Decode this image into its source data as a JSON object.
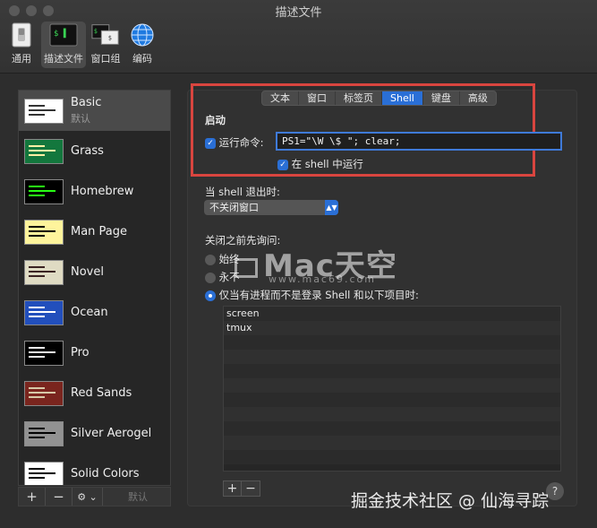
{
  "window": {
    "title": "描述文件"
  },
  "toolbar": {
    "items": [
      {
        "label": "通用",
        "icon": "general-switch-icon"
      },
      {
        "label": "描述文件",
        "icon": "terminal-profile-icon"
      },
      {
        "label": "窗口组",
        "icon": "window-group-icon"
      },
      {
        "label": "编码",
        "icon": "globe-icon"
      }
    ],
    "active_index": 1
  },
  "sidebar": {
    "profiles": [
      {
        "name": "Basic",
        "sub": "默认",
        "thumb_bg": "#ffffff",
        "line_color": "#333333"
      },
      {
        "name": "Grass",
        "sub": "",
        "thumb_bg": "#13773d",
        "line_color": "#fff0a5"
      },
      {
        "name": "Homebrew",
        "sub": "",
        "thumb_bg": "#000000",
        "line_color": "#28fe14"
      },
      {
        "name": "Man Page",
        "sub": "",
        "thumb_bg": "#fef49c",
        "line_color": "#000000"
      },
      {
        "name": "Novel",
        "sub": "",
        "thumb_bg": "#dfdbc3",
        "line_color": "#3b2322"
      },
      {
        "name": "Ocean",
        "sub": "",
        "thumb_bg": "#224fbc",
        "line_color": "#ffffff"
      },
      {
        "name": "Pro",
        "sub": "",
        "thumb_bg": "#000000",
        "line_color": "#f2f2f2"
      },
      {
        "name": "Red Sands",
        "sub": "",
        "thumb_bg": "#7a251e",
        "line_color": "#d7c9a7"
      },
      {
        "name": "Silver Aerogel",
        "sub": "",
        "thumb_bg": "#929292",
        "line_color": "#000000"
      },
      {
        "name": "Solid Colors",
        "sub": "",
        "thumb_bg": "#ffffff",
        "line_color": "#000000"
      }
    ],
    "selected_index": 0,
    "bottom_bar": {
      "add": "+",
      "remove": "−",
      "gear": "⚙ ⌄",
      "default_label": "默认"
    }
  },
  "tabs": {
    "items": [
      "文本",
      "窗口",
      "标签页",
      "Shell",
      "键盘",
      "高级"
    ],
    "active": "Shell"
  },
  "startup": {
    "section_label": "启动",
    "run_command_label": "运行命令:",
    "run_command_value": "PS1=\"\\W \\$ \"; clear;",
    "run_in_shell_label": "在 shell 中运行"
  },
  "on_exit": {
    "label": "当 shell 退出时:",
    "selected": "不关闭窗口"
  },
  "ask_before_close": {
    "label": "关闭之前先询问:",
    "options": [
      "始终",
      "永不",
      "仅当有进程而不是登录 Shell 和以下项目时:"
    ],
    "selected_index": 2
  },
  "process_list": {
    "items": [
      "screen",
      "tmux"
    ]
  },
  "table_bar": {
    "add": "+",
    "remove": "−"
  },
  "help": {
    "label": "?"
  },
  "watermarks": {
    "brand": "Mac天空",
    "url": "www.mac69.com",
    "credit": "掘金技术社区 @ 仙海寻踪"
  },
  "colors": {
    "accent": "#2a6fd6",
    "highlight_box": "#d9453f"
  }
}
